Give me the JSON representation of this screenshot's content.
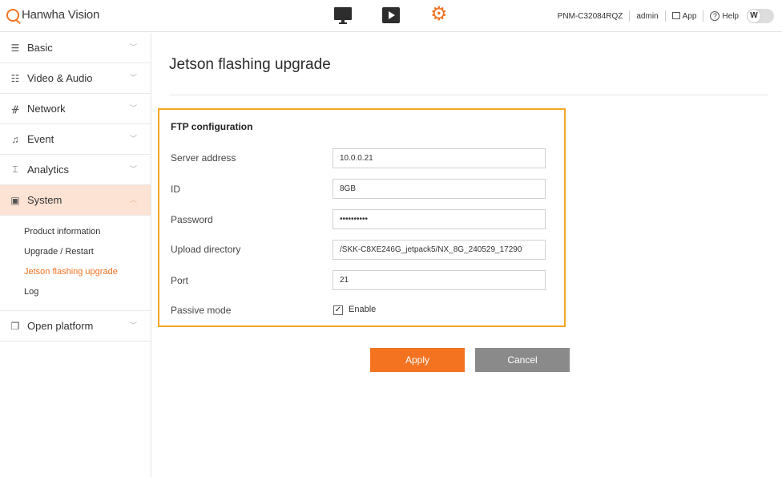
{
  "header": {
    "logo_text": "Hanwha Vision",
    "center_icons": [
      "monitor-icon",
      "play-icon",
      "gear-icon"
    ],
    "device_name": "PNM-C32084RQZ",
    "user": "admin",
    "app_label": "App",
    "help_label": "Help",
    "toggle_letter": "W",
    "accent_color": "#f37321"
  },
  "sidebar": {
    "items": [
      {
        "label": "Basic",
        "icon": "list-icon"
      },
      {
        "label": "Video & Audio",
        "icon": "sliders-icon"
      },
      {
        "label": "Network",
        "icon": "network-icon"
      },
      {
        "label": "Event",
        "icon": "bell-icon"
      },
      {
        "label": "Analytics",
        "icon": "analytics-icon"
      },
      {
        "label": "System",
        "icon": "system-icon"
      },
      {
        "label": "Open platform",
        "icon": "open-platform-icon"
      }
    ],
    "system_sub_items": [
      {
        "label": "Product information"
      },
      {
        "label": "Upgrade / Restart"
      },
      {
        "label": "Jetson flashing upgrade"
      },
      {
        "label": "Log"
      }
    ],
    "active_item": "System",
    "active_sub_item": "Jetson flashing upgrade"
  },
  "main": {
    "title": "Jetson flashing upgrade",
    "section_title": "FTP configuration",
    "fields": {
      "server_address": {
        "label": "Server address",
        "value": "10.0.0.21"
      },
      "id": {
        "label": "ID",
        "value": "8GB"
      },
      "password": {
        "label": "Password",
        "value": "••••••••••"
      },
      "upload_directory": {
        "label": "Upload directory",
        "value": "/SKK-C8XE246G_jetpack5/NX_8G_240529_17290"
      },
      "port": {
        "label": "Port",
        "value": "21"
      },
      "passive_mode": {
        "label": "Passive mode",
        "checkbox_label": "Enable",
        "checked": true
      }
    },
    "buttons": {
      "apply": "Apply",
      "cancel": "Cancel"
    }
  }
}
